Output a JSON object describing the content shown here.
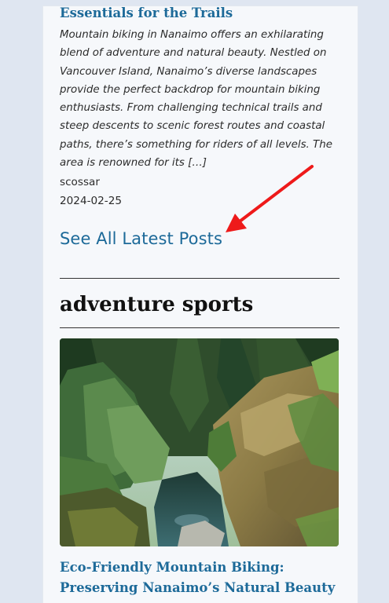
{
  "previous_post": {
    "title": "Essentials for the Trails",
    "excerpt": "Mountain biking in Nanaimo offers an exhilarating blend of adventure and natural beauty. Nestled on Vancouver Island, Nanaimo’s diverse landscapes provide the perfect backdrop for mountain biking enthusiasts. From challenging technical trails and steep descents to scenic forest routes and coastal paths, there’s something for riders of all levels. The area is renowned for its […]",
    "author": "scossar",
    "date": "2024-02-25"
  },
  "see_all_label": "See All Latest Posts",
  "section": {
    "title": "adventure sports"
  },
  "next_post": {
    "title": "Eco-Friendly Mountain Biking: Preserving Nanaimo’s Natural Beauty"
  },
  "colors": {
    "link": "#1d6a99",
    "annotation_arrow": "#ee1a1a"
  }
}
